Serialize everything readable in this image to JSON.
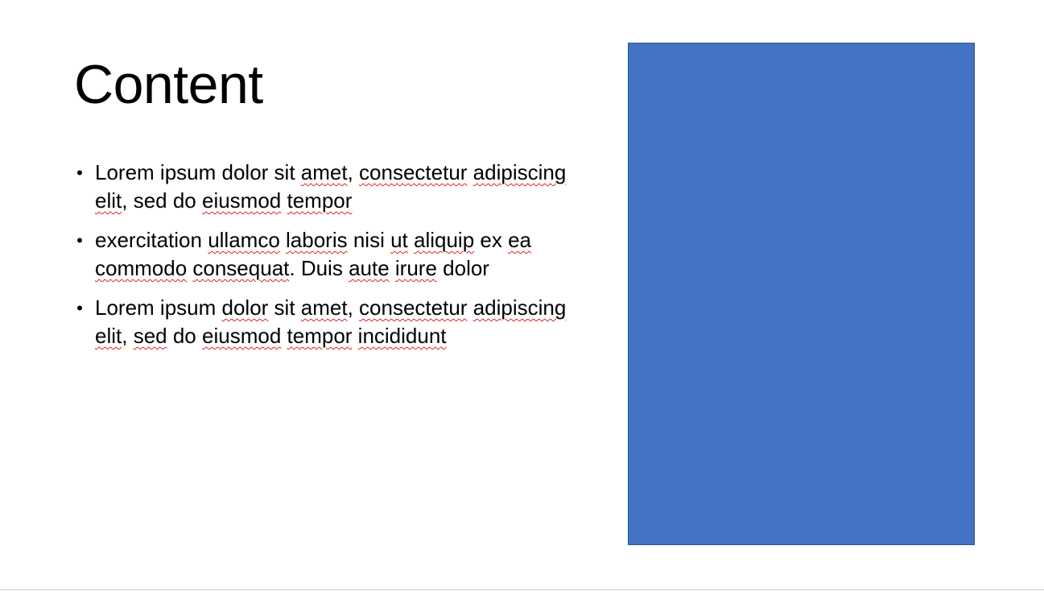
{
  "slide": {
    "title": "Content",
    "bullets": [
      {
        "segments": [
          {
            "text": "Lorem ipsum dolor sit ",
            "flag": false
          },
          {
            "text": "amet",
            "flag": true
          },
          {
            "text": ", ",
            "flag": false
          },
          {
            "text": "consectetur",
            "flag": true
          },
          {
            "text": " ",
            "flag": false
          },
          {
            "text": "adipiscing",
            "flag": true
          },
          {
            "text": " ",
            "flag": false
          },
          {
            "text": "elit",
            "flag": true
          },
          {
            "text": ", sed do ",
            "flag": false
          },
          {
            "text": "eiusmod",
            "flag": true
          },
          {
            "text": " ",
            "flag": false
          },
          {
            "text": "tempor",
            "flag": true
          }
        ]
      },
      {
        "segments": [
          {
            "text": "exercitation ",
            "flag": false
          },
          {
            "text": "ullamco",
            "flag": true
          },
          {
            "text": " ",
            "flag": false
          },
          {
            "text": "laboris",
            "flag": true
          },
          {
            "text": " nisi ",
            "flag": false
          },
          {
            "text": "ut",
            "flag": true
          },
          {
            "text": " ",
            "flag": false
          },
          {
            "text": "aliquip",
            "flag": true
          },
          {
            "text": " ex ",
            "flag": false
          },
          {
            "text": "ea",
            "flag": true
          },
          {
            "text": " ",
            "flag": false
          },
          {
            "text": "commodo",
            "flag": true
          },
          {
            "text": " ",
            "flag": false
          },
          {
            "text": "consequat",
            "flag": true
          },
          {
            "text": ". Duis ",
            "flag": false
          },
          {
            "text": "aute",
            "flag": true
          },
          {
            "text": " ",
            "flag": false
          },
          {
            "text": "irure",
            "flag": true
          },
          {
            "text": " dolor",
            "flag": false
          }
        ]
      },
      {
        "segments": [
          {
            "text": "Lorem ipsum ",
            "flag": false
          },
          {
            "text": "dolor",
            "flag": true
          },
          {
            "text": " sit ",
            "flag": false
          },
          {
            "text": "amet",
            "flag": true
          },
          {
            "text": ", ",
            "flag": false
          },
          {
            "text": "consectetur",
            "flag": true
          },
          {
            "text": " ",
            "flag": false
          },
          {
            "text": "adipiscing",
            "flag": true
          },
          {
            "text": " ",
            "flag": false
          },
          {
            "text": "elit",
            "flag": true
          },
          {
            "text": ", ",
            "flag": false
          },
          {
            "text": "sed",
            "flag": true
          },
          {
            "text": " do ",
            "flag": false
          },
          {
            "text": "eiusmod",
            "flag": true
          },
          {
            "text": " ",
            "flag": false
          },
          {
            "text": "tempor",
            "flag": true
          },
          {
            "text": " ",
            "flag": false
          },
          {
            "text": "incididunt",
            "flag": true
          }
        ]
      }
    ],
    "bullet_glyph": "•",
    "placeholder_color": "#4472c4",
    "spellcheck_color": "#e02020"
  }
}
